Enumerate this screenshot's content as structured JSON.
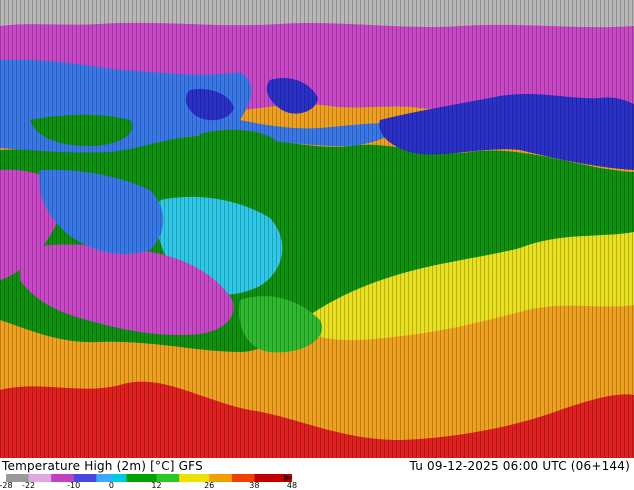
{
  "footer": {
    "title": "Temperature High (2m) [°C] GFS",
    "datetime": "Tu 09-12-2025 06:00 UTC (06+144)"
  },
  "colorbar": {
    "labels": [
      "-28",
      "-22",
      "-10",
      "0",
      "12",
      "26",
      "38",
      "48"
    ],
    "stops": [
      {
        "value": -28,
        "color": "#9a9a9a"
      },
      {
        "value": -22,
        "color": "#e0a8e0"
      },
      {
        "value": -16,
        "color": "#c040c0"
      },
      {
        "value": -10,
        "color": "#4848e0"
      },
      {
        "value": -4,
        "color": "#40a8ff"
      },
      {
        "value": 0,
        "color": "#00c8e8"
      },
      {
        "value": 4,
        "color": "#00a000"
      },
      {
        "value": 12,
        "color": "#28c828"
      },
      {
        "value": 18,
        "color": "#f0e000"
      },
      {
        "value": 26,
        "color": "#f0a000"
      },
      {
        "value": 32,
        "color": "#f04000"
      },
      {
        "value": 38,
        "color": "#c00000"
      },
      {
        "value": 48,
        "color": "#500000"
      }
    ]
  },
  "map": {
    "zone_colors": {
      "polar": "#b8b8b8",
      "cold_magenta": "#c848c8",
      "deep_blue": "#2a30c8",
      "mid_blue": "#3a78e8",
      "cyan": "#30c8e8",
      "green": "#109010",
      "bright_green": "#30b830",
      "yellow": "#e8e020",
      "orange": "#f0a020",
      "red": "#e02020"
    }
  }
}
